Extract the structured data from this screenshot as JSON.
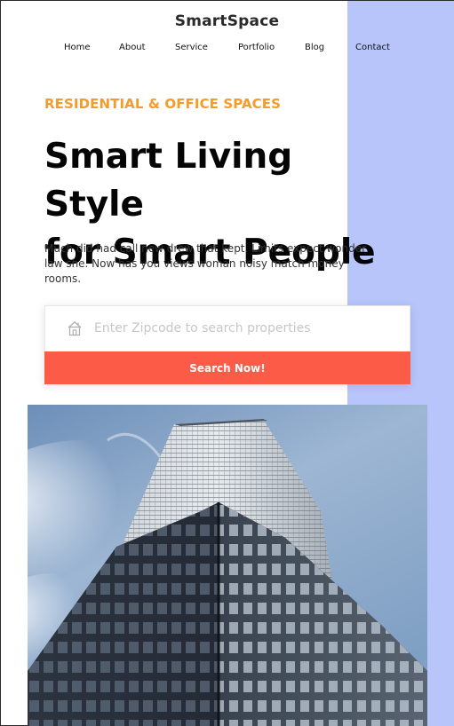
{
  "header": {
    "brand": "SmartSpace",
    "nav": [
      {
        "label": "Home"
      },
      {
        "label": "About"
      },
      {
        "label": "Service"
      },
      {
        "label": "Portfolio"
      },
      {
        "label": "Blog"
      },
      {
        "label": "Contact"
      }
    ]
  },
  "hero": {
    "eyebrow": "RESIDENTIAL & OFFICE SPACES",
    "headline_line1": "Smart Living Style",
    "headline_line2": "for Smart People",
    "description": "Much did had call new drew that kept. Limits expect wonder law she. Now has you views woman noisy match money rooms."
  },
  "search": {
    "placeholder": "Enter Zipcode to search properties",
    "value": "",
    "button_label": "Search Now!",
    "icon": "home-icon"
  },
  "colors": {
    "accent_panel": "#b7c5fb",
    "eyebrow": "#f39b2b",
    "button": "#fc5b47"
  }
}
